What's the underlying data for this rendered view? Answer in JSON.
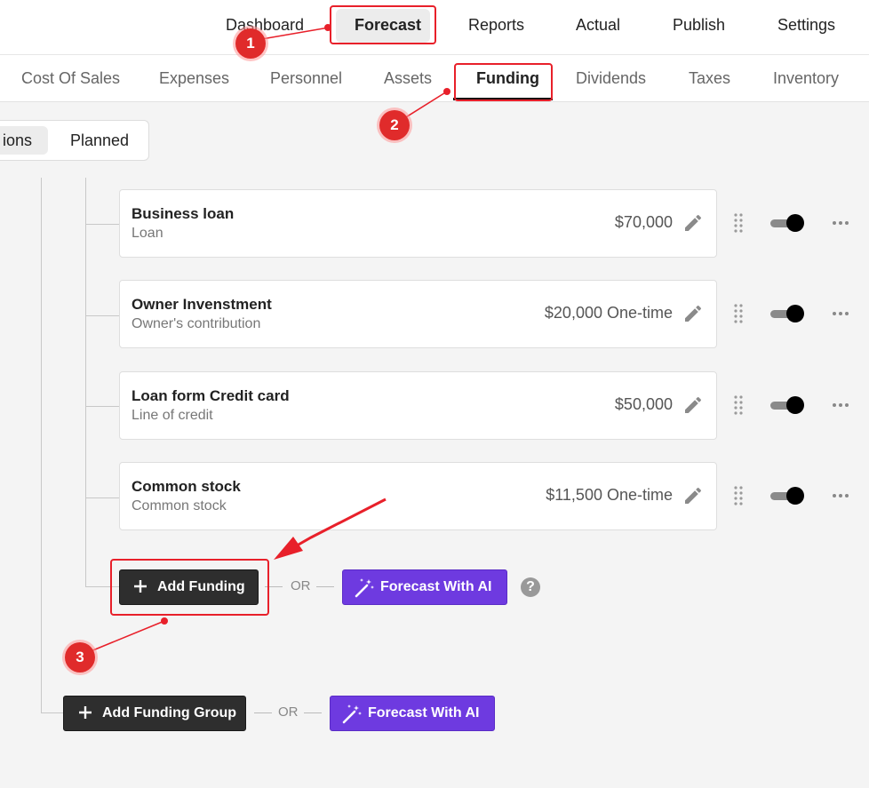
{
  "topnav": {
    "items": [
      {
        "label": "Dashboard"
      },
      {
        "label": "Forecast",
        "active": true
      },
      {
        "label": "Reports"
      },
      {
        "label": "Actual"
      },
      {
        "label": "Publish"
      },
      {
        "label": "Settings"
      }
    ]
  },
  "subnav": {
    "items": [
      {
        "label": "Cost Of Sales"
      },
      {
        "label": "Expenses"
      },
      {
        "label": "Personnel"
      },
      {
        "label": "Assets"
      },
      {
        "label": "Funding",
        "active": true
      },
      {
        "label": "Dividends"
      },
      {
        "label": "Taxes"
      },
      {
        "label": "Inventory"
      }
    ]
  },
  "view_toggle": {
    "options": [
      "ions",
      "Planned"
    ]
  },
  "funding_items": [
    {
      "title": "Business loan",
      "subtitle": "Loan",
      "amount": "$70,000",
      "enabled": true
    },
    {
      "title": "Owner Invenstment",
      "subtitle": "Owner's contribution",
      "amount": "$20,000 One-time",
      "enabled": true
    },
    {
      "title": "Loan form Credit card",
      "subtitle": "Line of credit",
      "amount": "$50,000",
      "enabled": true
    },
    {
      "title": "Common stock",
      "subtitle": "Common stock",
      "amount": "$11,500 One-time",
      "enabled": true
    }
  ],
  "actions": {
    "add_funding": "Add Funding",
    "or": "OR",
    "forecast_ai": "Forecast With AI",
    "help": "?",
    "add_group": "Add Funding Group"
  },
  "annotations": [
    "1",
    "2",
    "3"
  ],
  "colors": {
    "accent_purple": "#6e3ae0",
    "dark_button": "#2e2e2e",
    "annotation_red": "#e02b2b"
  }
}
